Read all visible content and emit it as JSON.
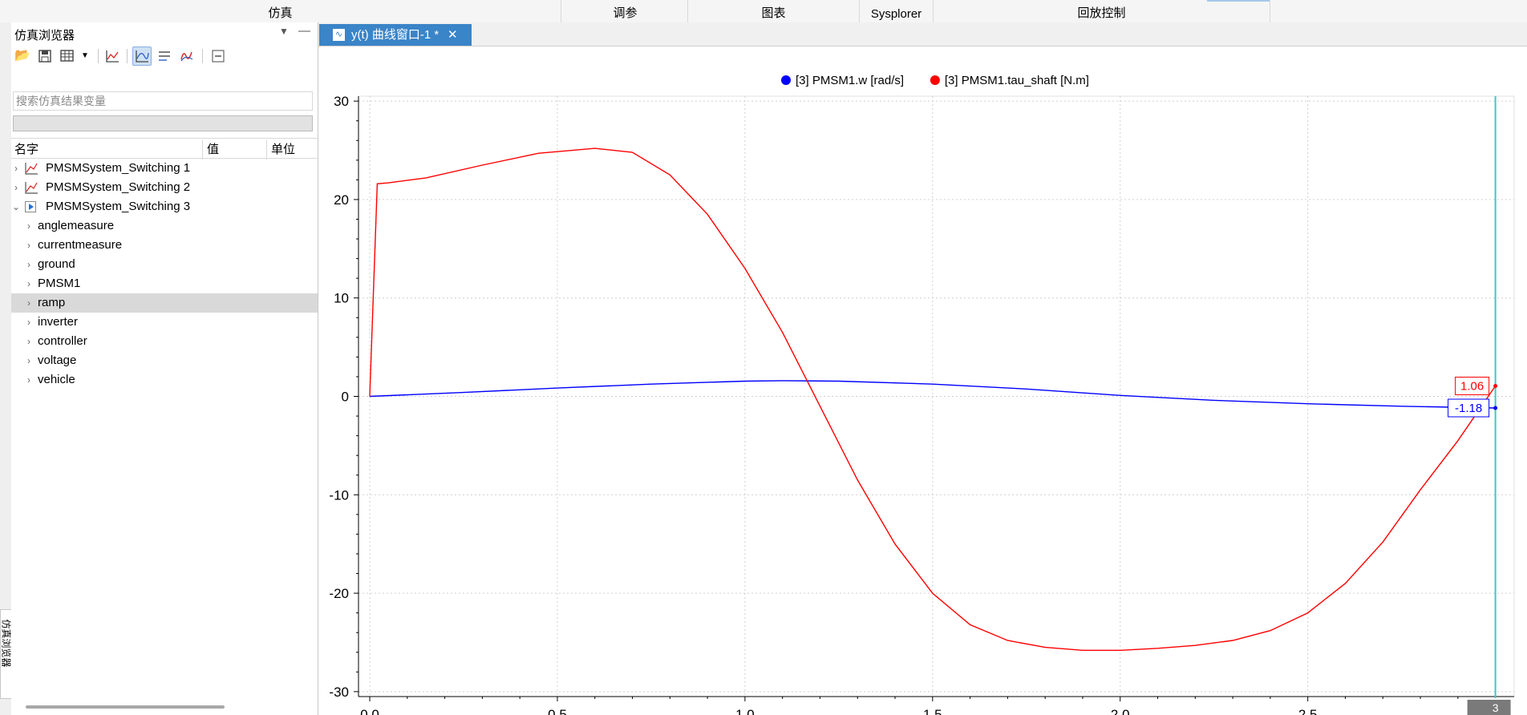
{
  "ribbon": {
    "tabs": [
      "仿真",
      "调参",
      "图表",
      "Sysplorer",
      "回放控制"
    ]
  },
  "side_tab": "仿真浏览器",
  "browser": {
    "title": "仿真浏览器",
    "search_placeholder": "搜索仿真结果变量",
    "columns": {
      "name": "名字",
      "value": "值",
      "unit": "单位"
    },
    "tree": [
      {
        "label": "PMSMSystem_Switching 1",
        "level": 0,
        "expanded": false,
        "icon": "plot-result-icon"
      },
      {
        "label": "PMSMSystem_Switching 2",
        "level": 0,
        "expanded": false,
        "icon": "plot-result-icon"
      },
      {
        "label": "PMSMSystem_Switching 3",
        "level": 0,
        "expanded": true,
        "icon": "active-result-icon"
      },
      {
        "label": "anglemeasure",
        "level": 1,
        "expanded": false
      },
      {
        "label": "currentmeasure",
        "level": 1,
        "expanded": false
      },
      {
        "label": "ground",
        "level": 1,
        "expanded": false
      },
      {
        "label": "PMSM1",
        "level": 1,
        "expanded": false
      },
      {
        "label": "ramp",
        "level": 1,
        "expanded": false,
        "selected": true
      },
      {
        "label": "inverter",
        "level": 1,
        "expanded": false
      },
      {
        "label": "controller",
        "level": 1,
        "expanded": false
      },
      {
        "label": "voltage",
        "level": 1,
        "expanded": false
      },
      {
        "label": "vehicle",
        "level": 1,
        "expanded": false
      }
    ]
  },
  "plot_window": {
    "tab_label": "y(t) 曲线窗口-1 *",
    "close_glyph": "✕"
  },
  "chart_data": {
    "type": "line",
    "xlim": [
      -0.03,
      3.05
    ],
    "ylim": [
      -30.5,
      30.5
    ],
    "x_ticks": [
      0.0,
      0.5,
      1.0,
      1.5,
      2.0,
      2.5
    ],
    "x_tick_labels": [
      "0.0",
      "0.5",
      "1.0",
      "1.5",
      "2.0",
      "2.5"
    ],
    "y_ticks": [
      -30,
      -20,
      -10,
      0,
      10,
      20,
      30
    ],
    "y_tick_labels": [
      "-30",
      "-20",
      "-10",
      "0",
      "10",
      "20",
      "30"
    ],
    "grid": true,
    "legend_position": "top-center",
    "cursor_x": 3.0,
    "cursor_label": "3",
    "series": [
      {
        "name": "[3] PMSM1.w [rad/s]",
        "color": "#0000ff",
        "end_label": "-1.18",
        "x": [
          0.0,
          0.25,
          0.5,
          0.75,
          1.0,
          1.1,
          1.25,
          1.5,
          1.75,
          2.0,
          2.25,
          2.5,
          2.75,
          3.0
        ],
        "y": [
          0.0,
          0.4,
          0.85,
          1.25,
          1.55,
          1.6,
          1.55,
          1.25,
          0.75,
          0.1,
          -0.4,
          -0.75,
          -1.0,
          -1.18
        ]
      },
      {
        "name": "[3] PMSM1.tau_shaft [N.m]",
        "color": "#ff0000",
        "end_label": "1.06",
        "x": [
          0.0,
          0.02,
          0.05,
          0.15,
          0.3,
          0.45,
          0.6,
          0.7,
          0.8,
          0.9,
          1.0,
          1.1,
          1.2,
          1.3,
          1.4,
          1.5,
          1.6,
          1.7,
          1.8,
          1.9,
          2.0,
          2.1,
          2.2,
          2.3,
          2.4,
          2.5,
          2.6,
          2.7,
          2.8,
          2.9,
          3.0
        ],
        "y": [
          0.0,
          21.6,
          21.7,
          22.2,
          23.5,
          24.7,
          25.2,
          24.8,
          22.5,
          18.5,
          13.0,
          6.5,
          -1.0,
          -8.5,
          -15.0,
          -20.0,
          -23.2,
          -24.8,
          -25.5,
          -25.8,
          -25.8,
          -25.6,
          -25.3,
          -24.8,
          -23.8,
          -22.0,
          -19.0,
          -14.8,
          -9.5,
          -4.5,
          1.06
        ]
      }
    ]
  }
}
